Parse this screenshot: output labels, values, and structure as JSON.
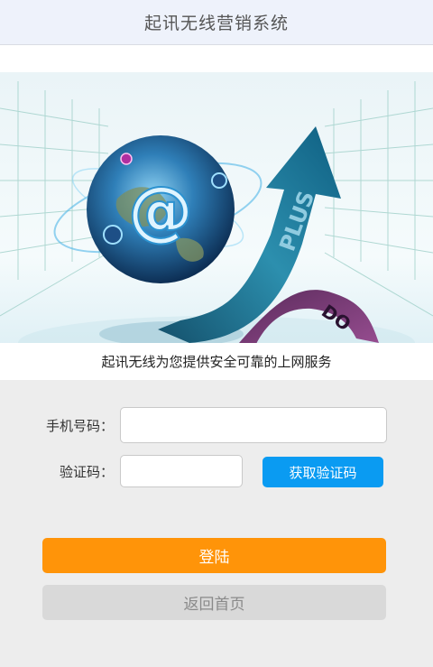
{
  "header": {
    "title": "起讯无线营销系统"
  },
  "banner": {
    "plus_text": "PLUS",
    "down_text": "DO",
    "at_symbol": "@",
    "tagline": "起讯无线为您提供安全可靠的上网服务",
    "colors": {
      "arrow": "#1e7e9a",
      "ribbon": "#7a3a78",
      "globe": "#2a6fa6"
    }
  },
  "form": {
    "phone_label": "手机号码：",
    "phone_value": "",
    "phone_placeholder": "",
    "code_label": "验证码：",
    "code_value": "",
    "code_placeholder": "",
    "get_code_button": "获取验证码"
  },
  "actions": {
    "login_button": "登陆",
    "back_button": "返回首页"
  },
  "colors": {
    "header_bg": "#eef2fb",
    "page_bg": "#ededed",
    "primary_blue": "#0a9bf2",
    "primary_orange": "#ff9409",
    "disabled_gray": "#d9d9d9"
  }
}
